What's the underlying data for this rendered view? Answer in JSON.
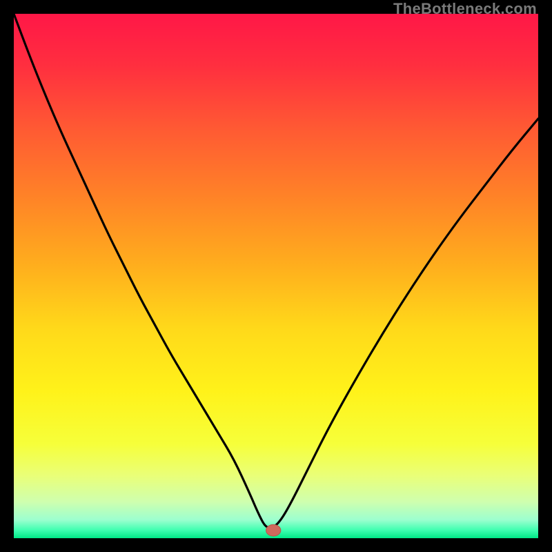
{
  "watermark": "TheBottleneck.com",
  "colors": {
    "frame": "#000000",
    "curve": "#000000",
    "marker_fill": "#cf6a5d",
    "marker_stroke": "#b6564a",
    "gradient_stops": [
      {
        "offset": 0.0,
        "color": "#ff1747"
      },
      {
        "offset": 0.1,
        "color": "#ff2f3f"
      },
      {
        "offset": 0.22,
        "color": "#ff5a33"
      },
      {
        "offset": 0.35,
        "color": "#ff8327"
      },
      {
        "offset": 0.48,
        "color": "#ffae1d"
      },
      {
        "offset": 0.6,
        "color": "#ffd91a"
      },
      {
        "offset": 0.72,
        "color": "#fff21a"
      },
      {
        "offset": 0.82,
        "color": "#f6ff3a"
      },
      {
        "offset": 0.88,
        "color": "#eaff77"
      },
      {
        "offset": 0.93,
        "color": "#cfffae"
      },
      {
        "offset": 0.965,
        "color": "#9cffcf"
      },
      {
        "offset": 0.985,
        "color": "#3dffb0"
      },
      {
        "offset": 1.0,
        "color": "#00e887"
      }
    ]
  },
  "chart_data": {
    "type": "line",
    "title": "",
    "xlabel": "",
    "ylabel": "",
    "xlim": [
      0,
      100
    ],
    "ylim": [
      0,
      100
    ],
    "grid": false,
    "legend": false,
    "notch_x": 48,
    "marker": {
      "x": 49.5,
      "y": 1.5,
      "rx": 1.4,
      "ry": 1.1
    },
    "x": [
      0,
      3,
      6,
      9,
      12,
      15,
      18,
      21,
      24,
      27,
      30,
      33,
      36,
      39,
      42,
      45,
      46.5,
      48,
      49.5,
      51,
      53,
      56,
      60,
      65,
      70,
      75,
      80,
      85,
      90,
      95,
      100
    ],
    "values": [
      100,
      92,
      84.5,
      77.5,
      71,
      64.5,
      58,
      52,
      46,
      40.5,
      35,
      30,
      25,
      20,
      15,
      8.5,
      5,
      2,
      2,
      3.5,
      7,
      13,
      21,
      30,
      38.5,
      46.5,
      54,
      61,
      67.5,
      74,
      80
    ]
  }
}
